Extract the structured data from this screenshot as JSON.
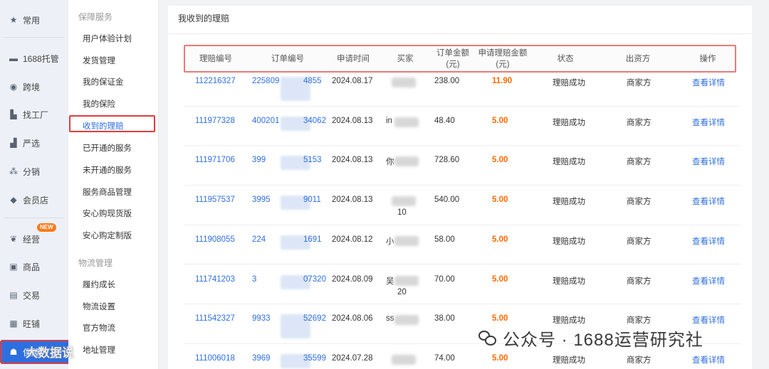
{
  "nav": [
    {
      "label": "常用",
      "icon": "star-icon"
    },
    {
      "label": "1688托管",
      "icon": "tray-icon"
    },
    {
      "label": "跨境",
      "icon": "globe-icon"
    },
    {
      "label": "找工厂",
      "icon": "factory-icon"
    },
    {
      "label": "严选",
      "icon": "chart-icon"
    },
    {
      "label": "分销",
      "icon": "network-icon"
    },
    {
      "label": "会员店",
      "icon": "diamond-icon"
    },
    {
      "label": "经营",
      "icon": "handshake-icon",
      "badge": "NEW"
    },
    {
      "label": "商品",
      "icon": "box-icon"
    },
    {
      "label": "交易",
      "icon": "receipt-icon"
    },
    {
      "label": "旺铺",
      "icon": "shop-icon"
    },
    {
      "label": "保障",
      "icon": "user-shield-icon"
    }
  ],
  "menu": {
    "group1": "保障服务",
    "items1": [
      "用户体验计划",
      "发货管理",
      "我的保证金",
      "我的保险",
      "收到的理赔",
      "已开通的服务",
      "未开通的服务",
      "服务商品管理",
      "安心购现货版",
      "安心购定制版"
    ],
    "group2": "物流管理",
    "items2": [
      "履约成长",
      "物流设置",
      "官方物流",
      "地址管理"
    ]
  },
  "page": {
    "title": "我收到的理赔"
  },
  "table": {
    "headers": [
      "理赔编号",
      "订单编号",
      "申请时间",
      "买家",
      "订单金额\n(元)",
      "申请理赔金额\n(元)",
      "状态",
      "出资方",
      "操作"
    ],
    "rows": [
      {
        "id": "112216327",
        "order_pre": "225809",
        "order_suf": "4855",
        "date": "2024.08.17",
        "buyer": "",
        "buyer2": "",
        "amount": "238.00",
        "claim": "11.90",
        "status": "理赔成功",
        "payer": "商家方",
        "action": "查看详情"
      },
      {
        "id": "111977328",
        "order_pre": "400201",
        "order_suf": "34062",
        "date": "2024.08.13",
        "buyer": "in",
        "buyer2": "",
        "amount": "48.40",
        "claim": "5.00",
        "status": "理赔成功",
        "payer": "商家方",
        "action": "查看详情"
      },
      {
        "id": "111971706",
        "order_pre": "399",
        "order_suf": "5153",
        "date": "2024.08.13",
        "buyer": "你",
        "buyer2": "",
        "amount": "728.60",
        "claim": "5.00",
        "status": "理赔成功",
        "payer": "商家方",
        "action": "查看详情"
      },
      {
        "id": "111957537",
        "order_pre": "3995",
        "order_suf": "9011",
        "date": "2024.08.13",
        "buyer": "",
        "buyer2": "10",
        "amount": "540.00",
        "claim": "5.00",
        "status": "理赔成功",
        "payer": "商家方",
        "action": "查看详情"
      },
      {
        "id": "111908055",
        "order_pre": "224",
        "order_suf": "1691",
        "date": "2024.08.12",
        "buyer": "小",
        "buyer2": "",
        "amount": "58.00",
        "claim": "5.00",
        "status": "理赔成功",
        "payer": "商家方",
        "action": "查看详情"
      },
      {
        "id": "111741203",
        "order_pre": "3",
        "order_suf": "07320",
        "date": "2024.08.09",
        "buyer": "吴",
        "buyer2": "20",
        "amount": "70.00",
        "claim": "5.00",
        "status": "理赔成功",
        "payer": "商家方",
        "action": "查看详情"
      },
      {
        "id": "111542327",
        "order_pre": "9933",
        "order_suf": "52692",
        "date": "2024.08.06",
        "buyer": "ss",
        "buyer2": "",
        "amount": "38.00",
        "claim": "5.00",
        "status": "理赔成功",
        "payer": "商家方",
        "action": "查看详情"
      },
      {
        "id": "111006018",
        "order_pre": "3969",
        "order_suf": "35599",
        "date": "2024.07.28",
        "buyer": "",
        "buyer2": "",
        "amount": "74.00",
        "claim": "5.00",
        "status": "理赔成功",
        "payer": "商家方",
        "action": "查看详情"
      }
    ]
  },
  "watermark": {
    "text": "公众号 · 1688运营研究社",
    "corner_text": "大数据说"
  },
  "colors": {
    "accent": "#2e6fe0",
    "claim": "#ff6a00",
    "highlight": "#e23c3c"
  }
}
